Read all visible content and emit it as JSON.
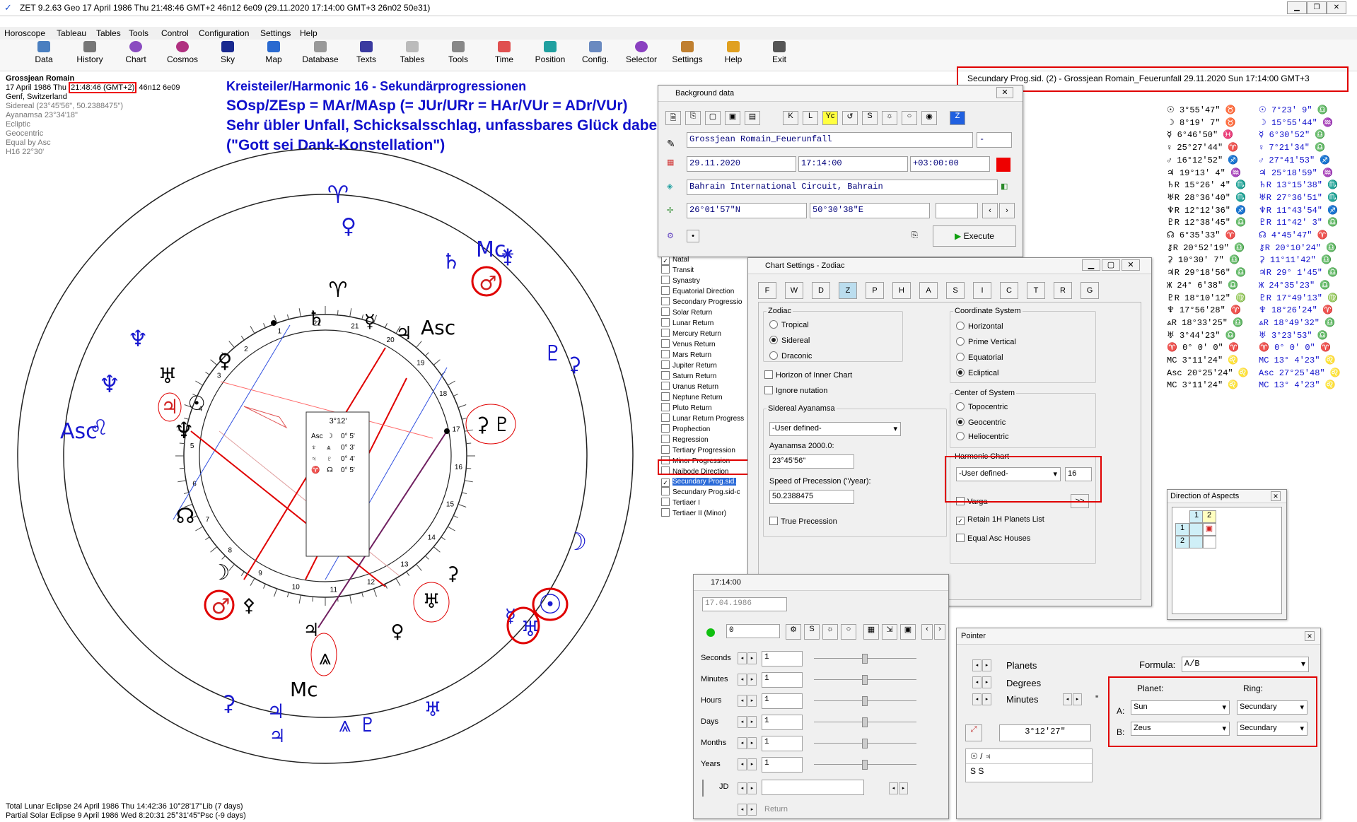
{
  "window": {
    "title": "ZET 9.2.63 Geo   17 April 1986  Thu  21:48:46 GMT+2 46n12  6e09  (29.11.2020  17:14:00 GMT+3 26n02 50e31)"
  },
  "menu": [
    "Horoscope",
    "Tableau",
    "Tables",
    "Tools",
    "Control",
    "Configuration",
    "Settings",
    "Help"
  ],
  "toolbar": [
    "Data",
    "History",
    "Chart",
    "Cosmos",
    "Sky",
    "Map",
    "Database",
    "Texts",
    "Tables",
    "Tools",
    "Time",
    "Position",
    "Config.",
    "Selector",
    "Settings",
    "Help",
    "Exit"
  ],
  "chart_info": {
    "name": "Grossjean Romain",
    "date_line": "17 April 1986  Thu",
    "time": "21:48:46 (GMT+2)",
    "coords": "46n12   6e09",
    "place": "Genf, Switzerland",
    "settings": [
      "Sidereal (23°45'56\", 50.2388475\")",
      "Ayanamsa 23°34'18\"",
      "Ecliptic",
      "Geocentric",
      "Equal by Asc",
      "H16  22°30'"
    ]
  },
  "annotation": {
    "line1": "Kreisteiler/Harmonic 16 - Sekundärprogressionen",
    "line2": "SOsp/ZEsp = MAr/MAsp (= JUr/URr = HAr/VUr = ADr/VUr)",
    "line3": "Sehr übler Unfall, Schicksalsschlag, unfassbares Glück dabei",
    "line4": "(\"Gott sei Dank-Konstellation\")"
  },
  "header_right": "Secundary Prog.sid. (2) - Grossjean Romain_Feuerunfall 29.11.2020  Sun 17:14:00 GMT+3",
  "chart_center": {
    "value": "3°12'",
    "rows": [
      [
        "Asc",
        "☽",
        "0° 5'"
      ],
      [
        "♆",
        "⩓",
        "0° 3'"
      ],
      [
        "♃",
        "♇",
        "0° 4'"
      ],
      [
        "♈",
        "☊",
        "0° 5'"
      ]
    ]
  },
  "house_numbers": [
    "1",
    "2",
    "3",
    "4",
    "5",
    "6",
    "7",
    "8",
    "9",
    "10",
    "11",
    "12",
    "13",
    "14",
    "15",
    "16",
    "17",
    "18",
    "19",
    "20",
    "21",
    "22"
  ],
  "chart_labels": {
    "mc": "Mc",
    "asc": "Asc",
    "asc_outer": "Asc",
    "mc_outer": "Mc"
  },
  "positions_left": [
    [
      "☉",
      "3°55'47\"",
      "♉"
    ],
    [
      "☽",
      "8°19' 7\"",
      "♉"
    ],
    [
      "☿",
      "6°46'50\"",
      "♓"
    ],
    [
      "♀",
      "25°27'44\"",
      "♈"
    ],
    [
      "♂",
      "16°12'52\"",
      "♐"
    ],
    [
      "♃",
      "19°13' 4\"",
      "♒"
    ],
    [
      "♄R",
      "15°26' 4\"",
      "♏"
    ],
    [
      "♅R",
      "28°36'40\"",
      "♏"
    ],
    [
      "♆R",
      "12°12'36\"",
      "♐"
    ],
    [
      "♇R",
      "12°38'45\"",
      "♎"
    ],
    [
      "☊",
      "6°35'33\"",
      "♈"
    ],
    [
      "⚷R",
      "20°52'19\"",
      "♎"
    ],
    [
      "⚳",
      "10°30' 7\"",
      "♎"
    ],
    [
      "♃R",
      "29°18'56\"",
      "♎"
    ],
    [
      "Ж",
      "24° 6'38\"",
      "♎"
    ],
    [
      "♇R",
      "18°10'12\"",
      "♍"
    ],
    [
      "♆",
      "17°56'28\"",
      "♈"
    ],
    [
      "⩓R",
      "18°33'25\"",
      "♎"
    ],
    [
      "♅",
      "3°44'23\"",
      "♎"
    ],
    [
      "♈",
      "0° 0' 0\"",
      "♈"
    ],
    [
      "MC",
      "3°11'24\"",
      "♌"
    ],
    [
      "Asc",
      "20°25'24\"",
      "♌"
    ],
    [
      "MC",
      "3°11'24\"",
      "♌"
    ]
  ],
  "positions_right": [
    [
      "☉",
      "7°23' 9\"",
      "♎"
    ],
    [
      "☽",
      "15°55'44\"",
      "♒"
    ],
    [
      "☿",
      "6°30'52\"",
      "♎"
    ],
    [
      "♀",
      "7°21'34\"",
      "♎"
    ],
    [
      "♂",
      "27°41'53\"",
      "♐"
    ],
    [
      "♃",
      "25°18'59\"",
      "♒"
    ],
    [
      "♄R",
      "13°15'38\"",
      "♏"
    ],
    [
      "♅R",
      "27°36'51\"",
      "♏"
    ],
    [
      "♆R",
      "11°43'54\"",
      "♐"
    ],
    [
      "♇R",
      "11°42' 3\"",
      "♎"
    ],
    [
      "☊",
      "4°45'47\"",
      "♈"
    ],
    [
      "⚷R",
      "20°10'24\"",
      "♎"
    ],
    [
      "⚳",
      "11°11'42\"",
      "♎"
    ],
    [
      "♃R",
      "29° 1'45\"",
      "♎"
    ],
    [
      "Ж",
      "24°35'23\"",
      "♎"
    ],
    [
      "♇R",
      "17°49'13\"",
      "♍"
    ],
    [
      "♆",
      "18°26'24\"",
      "♈"
    ],
    [
      "⩓R",
      "18°49'32\"",
      "♎"
    ],
    [
      "♅",
      "3°23'53\"",
      "♎"
    ],
    [
      "♈",
      "0° 0' 0\"",
      "♈"
    ],
    [
      "MC",
      "13° 4'23\"",
      "♌"
    ],
    [
      "Asc",
      "27°25'48\"",
      "♌"
    ],
    [
      "MC",
      "13° 4'23\"",
      "♌"
    ]
  ],
  "background_data": {
    "title": "Background data",
    "name": "Grossjean Romain_Feuerunfall",
    "name_suffix": "-",
    "date": "29.11.2020",
    "time": "17:14:00",
    "tz": "+03:00:00",
    "place": "Bahrain International Circuit, Bahrain",
    "lat": "26°01'57\"N",
    "lon": "50°30'38\"E",
    "execute": "Execute"
  },
  "chart_types": [
    "Natal",
    "Transit",
    "Synastry",
    "Equatorial Direction",
    "Secondary Progressio",
    "Solar Return",
    "Lunar Return",
    "Mercury Return",
    "Venus Return",
    "Mars Return",
    "Jupiter Return",
    "Saturn Return",
    "Uranus Return",
    "Neptune Return",
    "Pluto Return",
    "Lunar Return Progress",
    "Prophection",
    "Regression",
    "Tertiary Progression",
    "Minor Progression",
    "Naibode Direction",
    "Secundary Prog.sid.",
    "Secundary Prog.sid-c",
    "Tertiaer I",
    "Tertiaer II (Minor)"
  ],
  "chart_settings": {
    "title": "Chart Settings - Zodiac",
    "zodiac_label": "Zodiac",
    "zodiac_options": [
      "Tropical",
      "Sidereal",
      "Draconic"
    ],
    "horizon_inner": "Horizon of Inner Chart",
    "ignore_nutation": "Ignore nutation",
    "sidereal_ayanamsa": "Sidereal Ayanamsa",
    "ayanamsa_select": "-User defined-",
    "ayanamsa_2000_label": "Ayanamsa 2000.0:",
    "ayanamsa_2000": "23°45'56\"",
    "precession_label": "Speed of Precession (''/year):",
    "precession": "50.2388475",
    "true_precession": "True Precession",
    "coord_label": "Coordinate System",
    "coord_options": [
      "Horizontal",
      "Prime Vertical",
      "Equatorial",
      "Ecliptical"
    ],
    "center_label": "Center of System",
    "center_options": [
      "Topocentric",
      "Geocentric",
      "Heliocentric"
    ],
    "harmonic_label": "Harmonic Chart",
    "harmonic_select": "-User defined-",
    "harmonic_value": "16",
    "varga": "Varga",
    "more": ">>",
    "retain": "Retain 1H Planets List",
    "equal_asc": "Equal Asc Houses",
    "tabs": [
      "F",
      "W",
      "D",
      "Z",
      "P",
      "H",
      "A",
      "S",
      "I",
      "C",
      "T",
      "R",
      "G"
    ]
  },
  "time_panel": {
    "title": "17:14:00",
    "date": "17.04.1986",
    "step": "0",
    "rows": [
      [
        "Seconds",
        "1"
      ],
      [
        "Minutes",
        "1"
      ],
      [
        "Hours",
        "1"
      ],
      [
        "Days",
        "1"
      ],
      [
        "Months",
        "1"
      ],
      [
        "Years",
        "1"
      ]
    ],
    "jd_label": "JD",
    "return_label": "Return"
  },
  "aspects": {
    "title": "Direction of Aspects",
    "h": [
      "1",
      "2"
    ],
    "v": [
      "1",
      "2"
    ]
  },
  "pointer": {
    "title": "Pointer",
    "rows": [
      "Planets",
      "Degrees",
      "Minutes"
    ],
    "quote": "\"",
    "formula_label": "Formula:",
    "formula": "A/B",
    "planet_label": "Planet:",
    "ring_label": "Ring:",
    "a_label": "A:",
    "a_planet": "Sun",
    "a_ring": "Secundary",
    "b_label": "B:",
    "b_planet": "Zeus",
    "b_ring": "Secundary",
    "value": "3°12'27\"",
    "list1": "☉ / ♃",
    "list2": "S   S"
  },
  "eclipses": [
    "Total Lunar Eclipse 24 April 1986 Thu 14:42:36 10°28'17\"Lib (7 days)",
    "Partial Solar Eclipse 9 April 1986 Wed  8:20:31 25°31'45\"Psc (-9 days)"
  ]
}
